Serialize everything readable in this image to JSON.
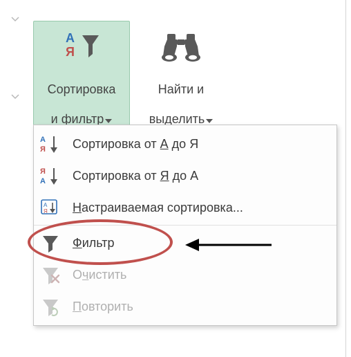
{
  "ribbon": {
    "sort_filter": {
      "line1": "Сортировка",
      "line2": "и фильтр"
    },
    "find_select": {
      "line1": "Найти и",
      "line2": "выделить"
    }
  },
  "menu": {
    "sort_az_pre": "Сортировка от ",
    "sort_az_mn": "А",
    "sort_az_post": " до Я",
    "sort_za_pre": "Сортировка от ",
    "sort_za_mn": "Я",
    "sort_za_post": " до А",
    "custom_mn": "Н",
    "custom_post": "астраиваемая сортировка...",
    "filter_mn": "Ф",
    "filter_post": "ильтр",
    "clear_pre": "О",
    "clear_mn": "ч",
    "clear_post": "истить",
    "reapply_mn": "П",
    "reapply_post": "овторить"
  }
}
